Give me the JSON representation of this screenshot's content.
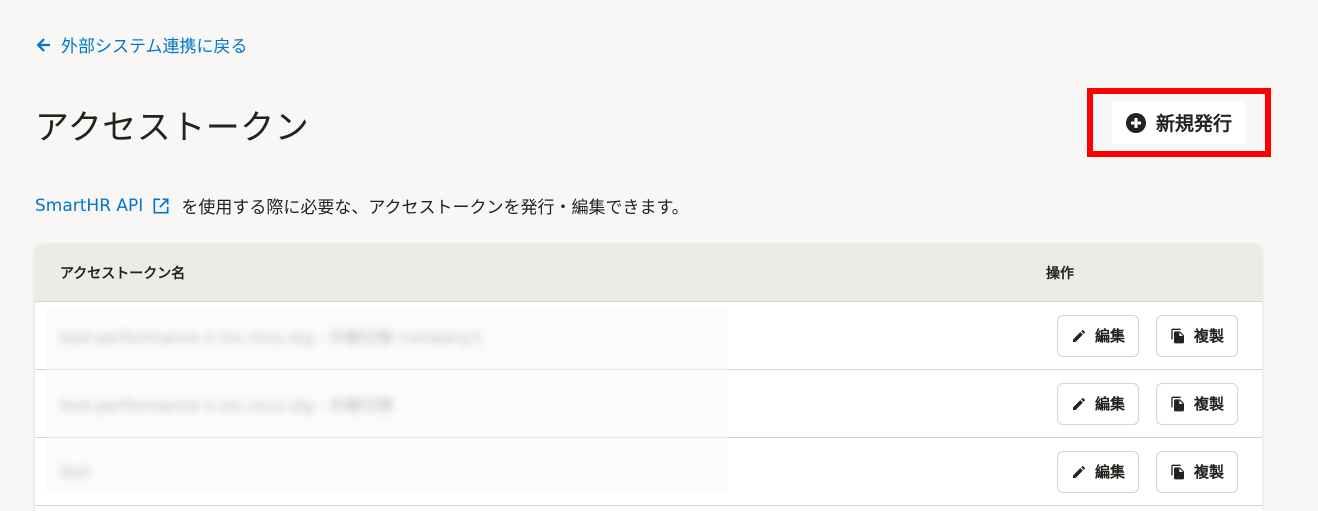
{
  "nav": {
    "back_label": "外部システム連携に戻る"
  },
  "header": {
    "title": "アクセストークン",
    "new_button_label": "新規発行"
  },
  "description": {
    "link_text": "SmartHR API",
    "text": "を使用する際に必要な、アクセストークンを発行・編集できます。"
  },
  "table": {
    "columns": {
      "name": "アクセストークン名",
      "ops": "操作"
    },
    "rows": [
      {
        "name": "test-performance-1-inc.mcu.stg - 外観切替 company1",
        "edit": "編集",
        "copy": "複製"
      },
      {
        "name": "test-performance-1-inc.mcu.stg - 外観切替",
        "edit": "編集",
        "copy": "複製"
      },
      {
        "name": "test",
        "edit": "編集",
        "copy": "複製"
      }
    ]
  },
  "colors": {
    "link": "#0077c7",
    "highlight": "#ff0000",
    "header_bg": "#edebe8",
    "page_bg": "#f8f7f6"
  }
}
